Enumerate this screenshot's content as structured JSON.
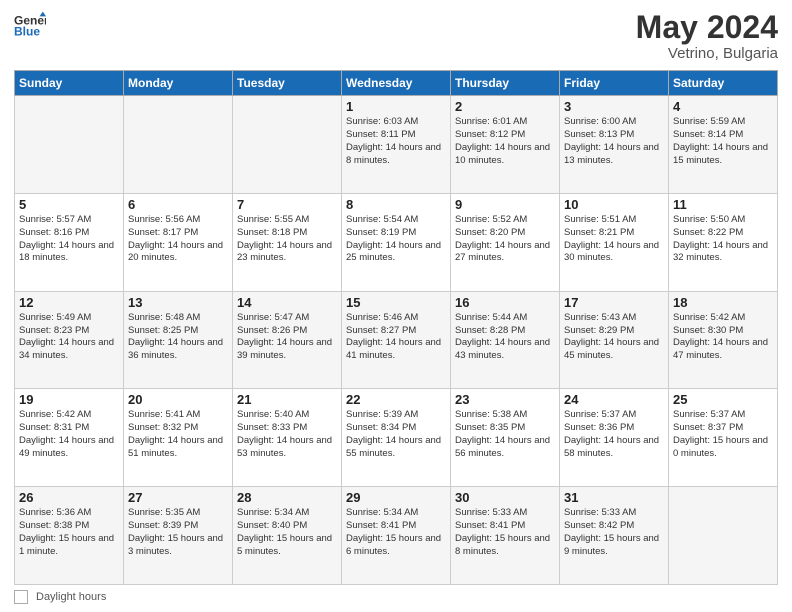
{
  "header": {
    "logo_line1": "General",
    "logo_line2": "Blue",
    "month": "May 2024",
    "location": "Vetrino, Bulgaria"
  },
  "days_of_week": [
    "Sunday",
    "Monday",
    "Tuesday",
    "Wednesday",
    "Thursday",
    "Friday",
    "Saturday"
  ],
  "footer": {
    "label": "Daylight hours"
  },
  "weeks": [
    [
      {
        "day": "",
        "info": ""
      },
      {
        "day": "",
        "info": ""
      },
      {
        "day": "",
        "info": ""
      },
      {
        "day": "1",
        "info": "Sunrise: 6:03 AM\nSunset: 8:11 PM\nDaylight: 14 hours\nand 8 minutes."
      },
      {
        "day": "2",
        "info": "Sunrise: 6:01 AM\nSunset: 8:12 PM\nDaylight: 14 hours\nand 10 minutes."
      },
      {
        "day": "3",
        "info": "Sunrise: 6:00 AM\nSunset: 8:13 PM\nDaylight: 14 hours\nand 13 minutes."
      },
      {
        "day": "4",
        "info": "Sunrise: 5:59 AM\nSunset: 8:14 PM\nDaylight: 14 hours\nand 15 minutes."
      }
    ],
    [
      {
        "day": "5",
        "info": "Sunrise: 5:57 AM\nSunset: 8:16 PM\nDaylight: 14 hours\nand 18 minutes."
      },
      {
        "day": "6",
        "info": "Sunrise: 5:56 AM\nSunset: 8:17 PM\nDaylight: 14 hours\nand 20 minutes."
      },
      {
        "day": "7",
        "info": "Sunrise: 5:55 AM\nSunset: 8:18 PM\nDaylight: 14 hours\nand 23 minutes."
      },
      {
        "day": "8",
        "info": "Sunrise: 5:54 AM\nSunset: 8:19 PM\nDaylight: 14 hours\nand 25 minutes."
      },
      {
        "day": "9",
        "info": "Sunrise: 5:52 AM\nSunset: 8:20 PM\nDaylight: 14 hours\nand 27 minutes."
      },
      {
        "day": "10",
        "info": "Sunrise: 5:51 AM\nSunset: 8:21 PM\nDaylight: 14 hours\nand 30 minutes."
      },
      {
        "day": "11",
        "info": "Sunrise: 5:50 AM\nSunset: 8:22 PM\nDaylight: 14 hours\nand 32 minutes."
      }
    ],
    [
      {
        "day": "12",
        "info": "Sunrise: 5:49 AM\nSunset: 8:23 PM\nDaylight: 14 hours\nand 34 minutes."
      },
      {
        "day": "13",
        "info": "Sunrise: 5:48 AM\nSunset: 8:25 PM\nDaylight: 14 hours\nand 36 minutes."
      },
      {
        "day": "14",
        "info": "Sunrise: 5:47 AM\nSunset: 8:26 PM\nDaylight: 14 hours\nand 39 minutes."
      },
      {
        "day": "15",
        "info": "Sunrise: 5:46 AM\nSunset: 8:27 PM\nDaylight: 14 hours\nand 41 minutes."
      },
      {
        "day": "16",
        "info": "Sunrise: 5:44 AM\nSunset: 8:28 PM\nDaylight: 14 hours\nand 43 minutes."
      },
      {
        "day": "17",
        "info": "Sunrise: 5:43 AM\nSunset: 8:29 PM\nDaylight: 14 hours\nand 45 minutes."
      },
      {
        "day": "18",
        "info": "Sunrise: 5:42 AM\nSunset: 8:30 PM\nDaylight: 14 hours\nand 47 minutes."
      }
    ],
    [
      {
        "day": "19",
        "info": "Sunrise: 5:42 AM\nSunset: 8:31 PM\nDaylight: 14 hours\nand 49 minutes."
      },
      {
        "day": "20",
        "info": "Sunrise: 5:41 AM\nSunset: 8:32 PM\nDaylight: 14 hours\nand 51 minutes."
      },
      {
        "day": "21",
        "info": "Sunrise: 5:40 AM\nSunset: 8:33 PM\nDaylight: 14 hours\nand 53 minutes."
      },
      {
        "day": "22",
        "info": "Sunrise: 5:39 AM\nSunset: 8:34 PM\nDaylight: 14 hours\nand 55 minutes."
      },
      {
        "day": "23",
        "info": "Sunrise: 5:38 AM\nSunset: 8:35 PM\nDaylight: 14 hours\nand 56 minutes."
      },
      {
        "day": "24",
        "info": "Sunrise: 5:37 AM\nSunset: 8:36 PM\nDaylight: 14 hours\nand 58 minutes."
      },
      {
        "day": "25",
        "info": "Sunrise: 5:37 AM\nSunset: 8:37 PM\nDaylight: 15 hours\nand 0 minutes."
      }
    ],
    [
      {
        "day": "26",
        "info": "Sunrise: 5:36 AM\nSunset: 8:38 PM\nDaylight: 15 hours\nand 1 minute."
      },
      {
        "day": "27",
        "info": "Sunrise: 5:35 AM\nSunset: 8:39 PM\nDaylight: 15 hours\nand 3 minutes."
      },
      {
        "day": "28",
        "info": "Sunrise: 5:34 AM\nSunset: 8:40 PM\nDaylight: 15 hours\nand 5 minutes."
      },
      {
        "day": "29",
        "info": "Sunrise: 5:34 AM\nSunset: 8:41 PM\nDaylight: 15 hours\nand 6 minutes."
      },
      {
        "day": "30",
        "info": "Sunrise: 5:33 AM\nSunset: 8:41 PM\nDaylight: 15 hours\nand 8 minutes."
      },
      {
        "day": "31",
        "info": "Sunrise: 5:33 AM\nSunset: 8:42 PM\nDaylight: 15 hours\nand 9 minutes."
      },
      {
        "day": "",
        "info": ""
      }
    ]
  ]
}
